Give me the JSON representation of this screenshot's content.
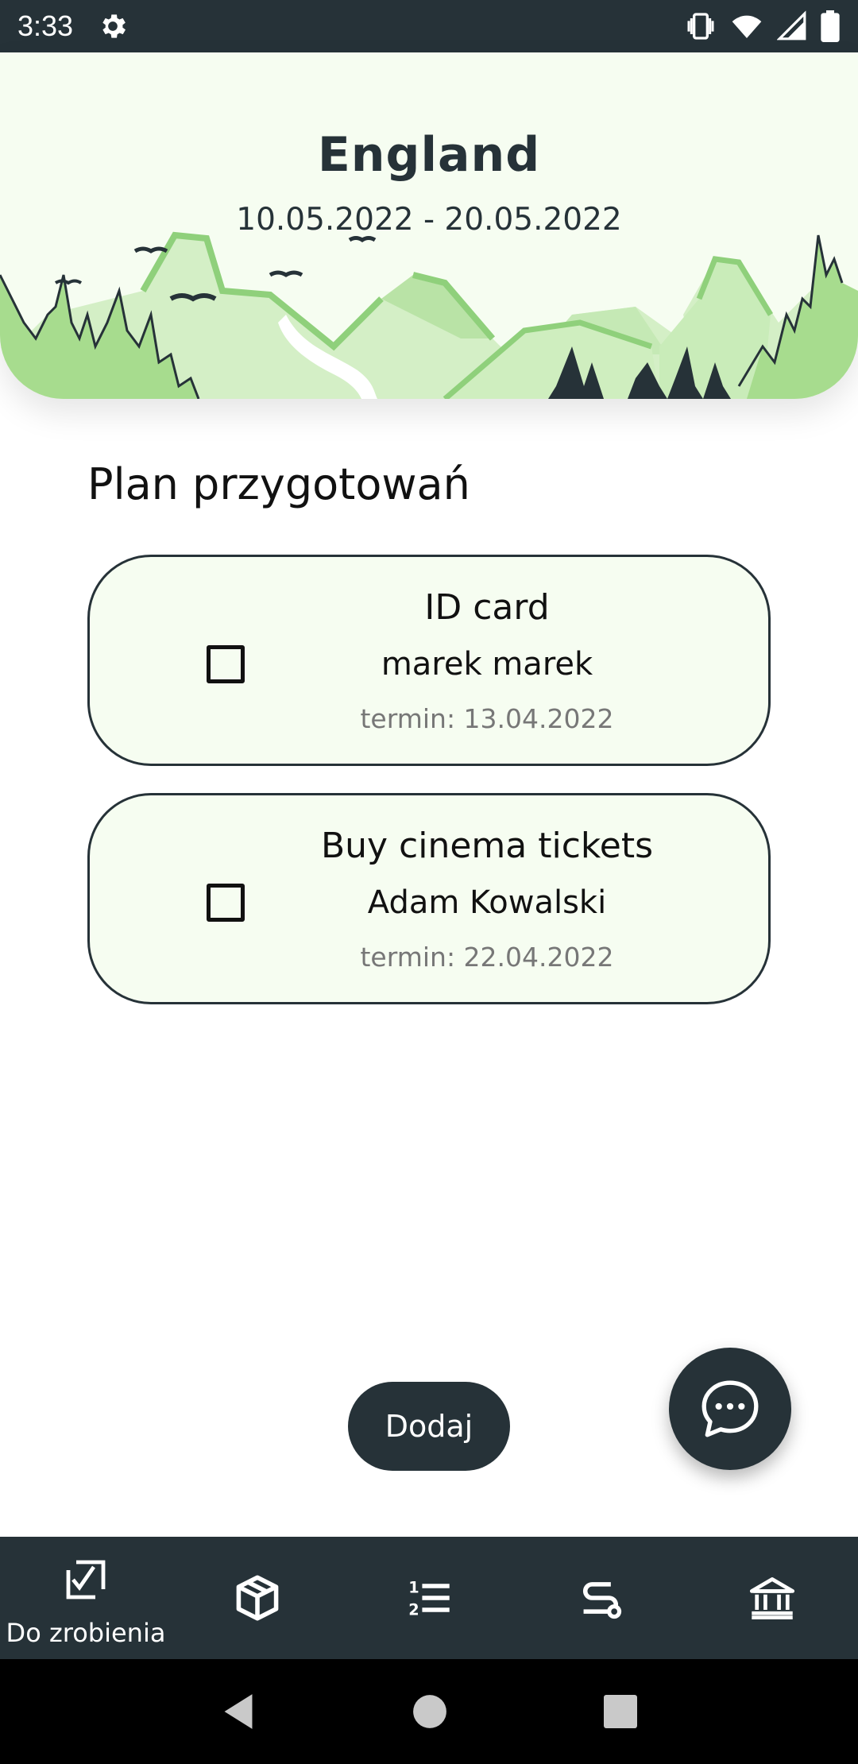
{
  "status_bar": {
    "time": "3:33",
    "icons": [
      "gear-icon",
      "vibrate-icon",
      "wifi-icon",
      "signal-icon",
      "battery-icon"
    ]
  },
  "header": {
    "title": "England",
    "dates": "10.05.2022 - 20.05.2022"
  },
  "section": {
    "title": "Plan przygotowań"
  },
  "tasks": [
    {
      "title": "ID card",
      "person": "marek marek",
      "deadline": "termin: 13.04.2022",
      "checked": false
    },
    {
      "title": "Buy cinema tickets",
      "person": "Adam Kowalski",
      "deadline": "termin: 22.04.2022",
      "checked": false
    }
  ],
  "buttons": {
    "add_label": "Dodaj",
    "chat_icon": "chat-bubble-icon"
  },
  "bottom_nav": {
    "items": [
      {
        "icon": "todo-check-icon",
        "label": "Do zrobienia",
        "active": true
      },
      {
        "icon": "package-icon",
        "label": "",
        "active": false
      },
      {
        "icon": "numbered-list-icon",
        "label": "",
        "active": false
      },
      {
        "icon": "route-icon",
        "label": "",
        "active": false
      },
      {
        "icon": "bank-icon",
        "label": "",
        "active": false
      }
    ]
  },
  "colors": {
    "dark": "#263238",
    "card_background": "#f6fdf1",
    "header_green": "#8fd07b"
  }
}
